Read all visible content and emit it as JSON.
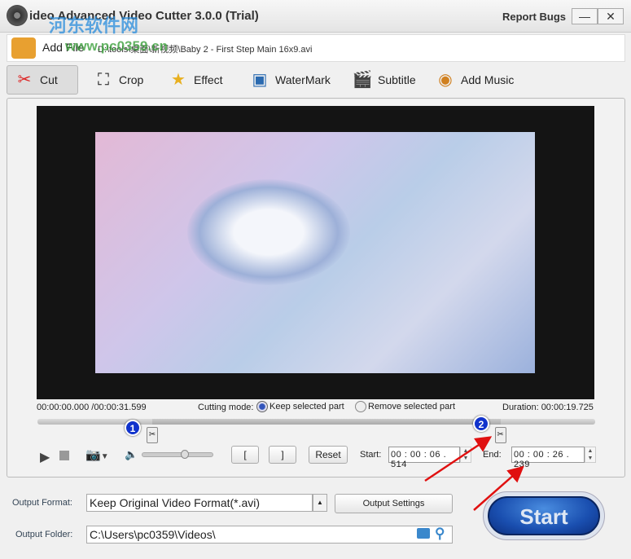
{
  "window": {
    "title": "ideo Advanced Video Cutter 3.0.0 (Trial)",
    "report_bugs": "Report Bugs",
    "minimize": "—",
    "close": "✕"
  },
  "watermark": {
    "site_name": "河东软件网",
    "url": "www.pc0359.cn"
  },
  "file": {
    "add_label": "Add File",
    "path": "D:\\tools\\桌面\\新视频\\Baby 2 - First Step Main 16x9.avi"
  },
  "tabs": [
    {
      "label": "Cut",
      "icon": "scissors-icon"
    },
    {
      "label": "Crop",
      "icon": "crop-icon"
    },
    {
      "label": "Effect",
      "icon": "star-icon"
    },
    {
      "label": "WaterMark",
      "icon": "watermark-icon"
    },
    {
      "label": "Subtitle",
      "icon": "subtitle-icon"
    },
    {
      "label": "Add Music",
      "icon": "music-icon"
    }
  ],
  "player": {
    "position": "00:00:00.000 /00:00:31.599",
    "cutting_mode_label": "Cutting mode:",
    "mode_keep": "Keep selected part",
    "mode_remove": "Remove selected part",
    "selected_mode": "keep",
    "duration": "Duration: 00:00:19.725",
    "start_fraction": 0.206,
    "end_fraction": 0.83,
    "volume_fraction": 0.6,
    "marker1": "1",
    "marker2": "2"
  },
  "controls": {
    "mark_in": "[",
    "mark_out": "]",
    "reset": "Reset",
    "start_label": "Start:",
    "start_value": "00 : 00 : 06 . 514",
    "end_label": "End:",
    "end_value": "00 : 00 : 26 . 239"
  },
  "output": {
    "format_label": "Output Format:",
    "format_value": "Keep Original Video Format(*.avi)",
    "settings_button": "Output Settings",
    "folder_label": "Output Folder:",
    "folder_value": "C:\\Users\\pc0359\\Videos\\",
    "start_button": "Start"
  },
  "colors": {
    "accent": "#1a4fb0",
    "arrow": "#e01010"
  }
}
